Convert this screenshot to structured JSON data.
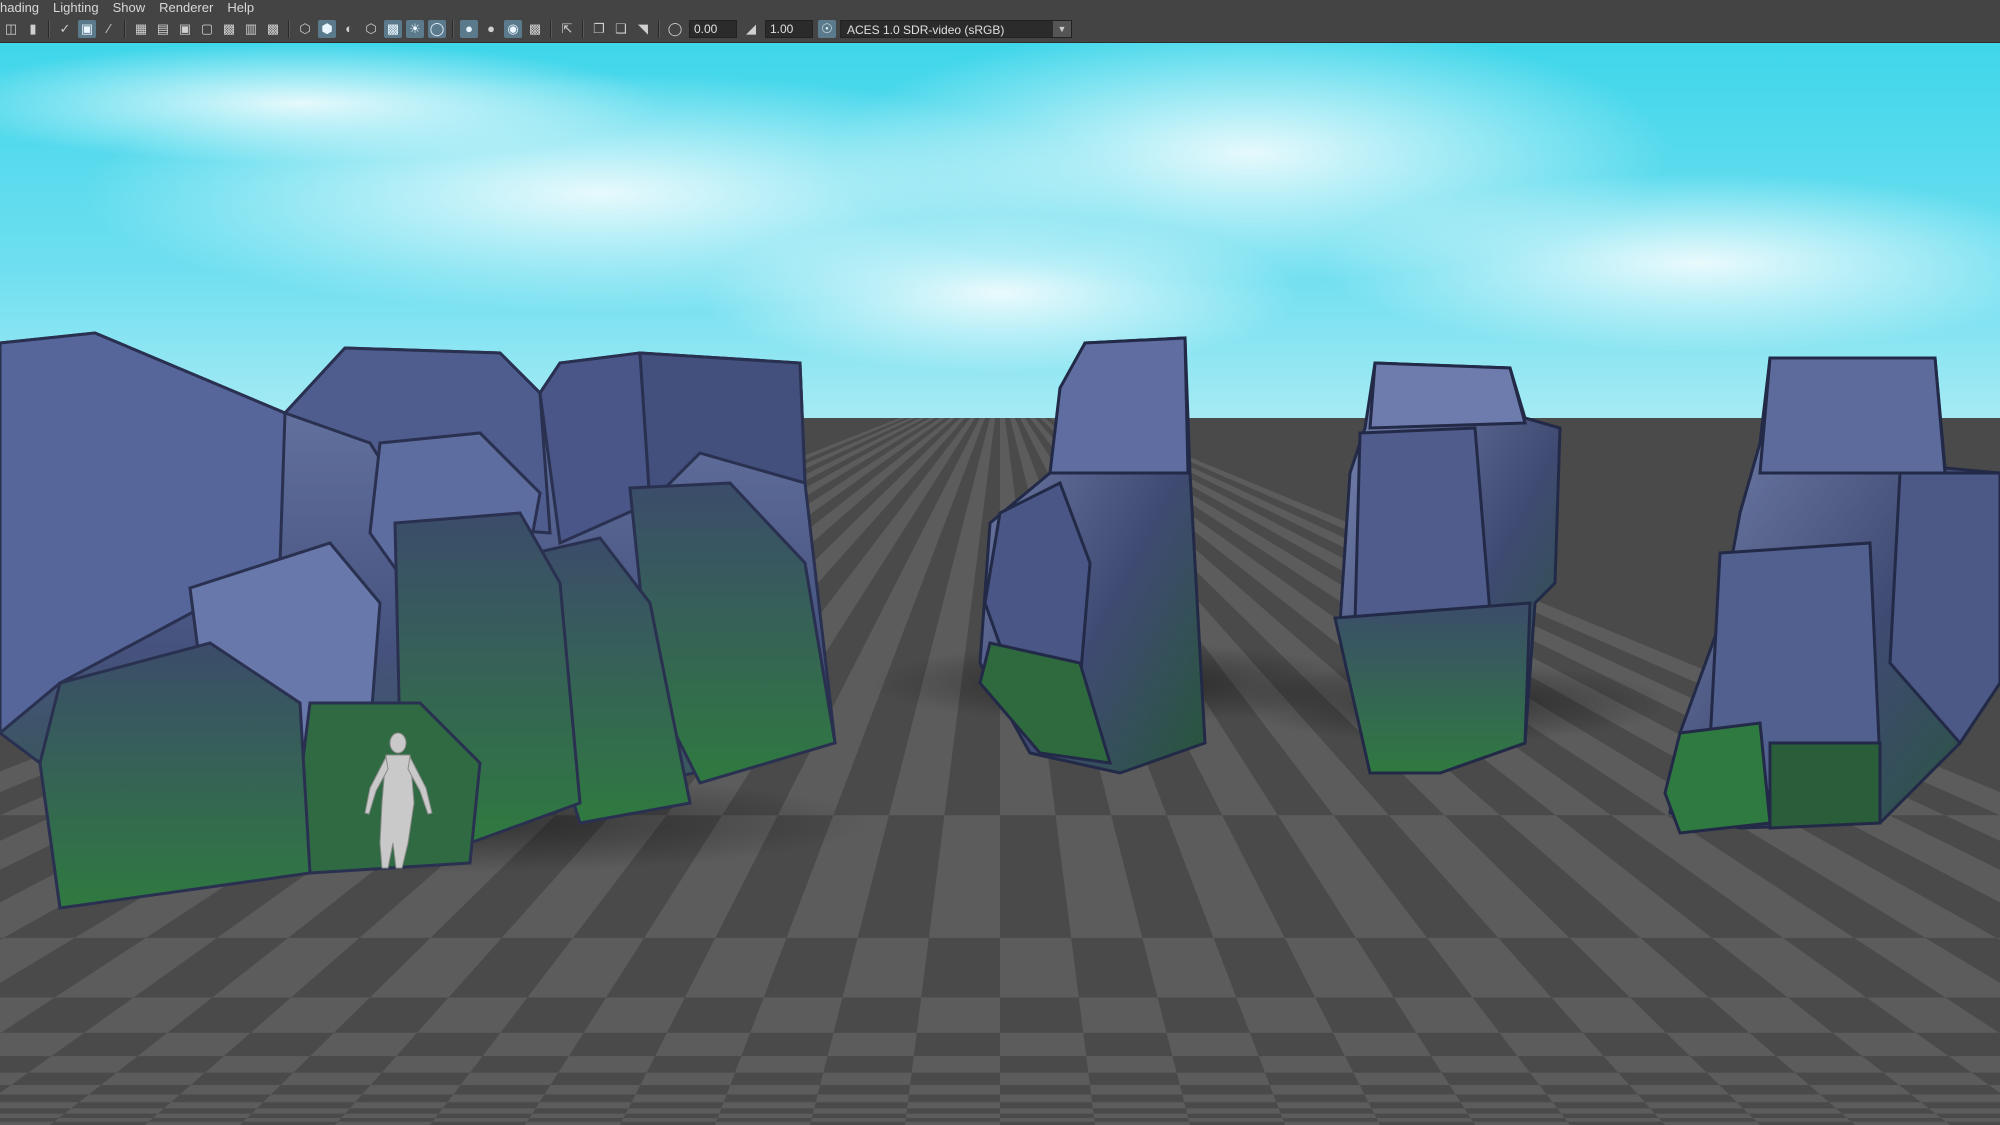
{
  "menubar": {
    "items": [
      "hading",
      "Lighting",
      "Show",
      "Renderer",
      "Help"
    ]
  },
  "toolbar": {
    "exposure_value": "0.00",
    "gamma_value": "1.00",
    "color_space": "ACES 1.0 SDR-video (sRGB)",
    "icons": [
      "camera-icon",
      "bookmark-icon",
      "snap-icon",
      "image-plane-icon",
      "brush-icon",
      "grid-icon",
      "film-gate-icon",
      "resolution-gate-icon",
      "gate-mask-icon",
      "field-chart-icon",
      "safe-action-icon",
      "safe-title-icon",
      "wireframe-icon",
      "smooth-shade-icon",
      "default-material-icon",
      "textured-icon",
      "use-lights-icon",
      "shadows-icon",
      "ambient-occlusion-icon",
      "motion-blur-icon",
      "multisample-icon",
      "isolate-select-icon",
      "xray-icon",
      "xray-joints-icon",
      "backface-icon",
      "exposure-icon",
      "gamma-icon",
      "color-management-icon",
      "dropdown-chevron-icon"
    ]
  },
  "colors": {
    "ui_bg": "#444444",
    "field_bg": "#2b2b2b",
    "active_icon": "#5b7b8c",
    "sky_top": "#2fd0e6",
    "grid_dark": "#3a3a3a",
    "grid_light": "#5c5c5c",
    "rock_blue": "#4a5a86",
    "moss_green": "#2e6b3c"
  },
  "scene": {
    "objects": [
      "rock-cliff-wall",
      "human-scale-reference",
      "rock-pillar-1",
      "rock-pillar-2",
      "rock-pillar-3"
    ]
  }
}
